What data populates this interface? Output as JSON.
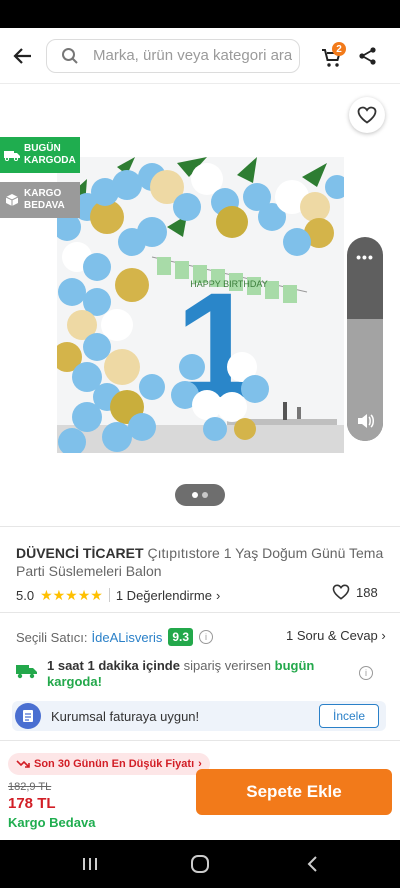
{
  "search": {
    "placeholder": "Marka, ürün veya kategori ara"
  },
  "cart": {
    "count": "2"
  },
  "badges": {
    "fast_shipping": [
      "BUGÜN",
      "KARGODA"
    ],
    "free_shipping": [
      "KARGO",
      "BEDAVA"
    ]
  },
  "banner": {
    "text": "HAPPY BIRTHDAY",
    "number": "1"
  },
  "gallery": {
    "page_count": 2,
    "active_index": 0,
    "volume_level": 0.6
  },
  "product": {
    "brand": "DÜVENCİ TİCARET",
    "name": "Çıtıpıtıstore 1 Yaş Doğum Günü Tema Parti Süslemeleri Balon",
    "rating": "5.0",
    "stars": 5,
    "reviews_label": "1 Değerlendirme",
    "favorites": "188"
  },
  "seller": {
    "label": "Seçili Satıcı:",
    "name": "İdeALisveris",
    "score": "9.3",
    "qa_label": "1 Soru & Cevap"
  },
  "shipping": {
    "time": "1 saat 1 dakika içinde",
    "middle": "sipariş verirsen",
    "highlight": "bugün kargoda!"
  },
  "invoice": {
    "text": "Kurumsal faturaya uygun!",
    "button": "İncele"
  },
  "pricing": {
    "low_price_label": "Son 30 Günün En Düşük Fiyatı",
    "old_price": "182,9 TL",
    "new_price": "178 TL",
    "free_shipping": "Kargo Bedava",
    "add_to_cart": "Sepete Ekle"
  },
  "colors": {
    "accent": "#f27a1a",
    "green": "#1fad4f",
    "price_red": "#d21e26",
    "link_blue": "#2a80c8"
  }
}
